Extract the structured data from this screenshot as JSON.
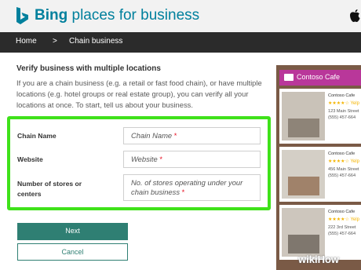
{
  "header": {
    "brand_bold": "Bing",
    "brand_rest": " places for business"
  },
  "breadcrumb": {
    "home": "Home",
    "separator": ">",
    "current": "Chain business"
  },
  "content": {
    "title": "Verify business with multiple locations",
    "description": "If you are a chain business (e.g. a retail or fast food chain), or have multiple locations (e.g. hotel groups or real estate group), you can verify all your locations at once. To start, tell us about your business."
  },
  "form": {
    "fields": [
      {
        "label": "Chain Name",
        "placeholder": "Chain Name",
        "required_mark": "*"
      },
      {
        "label": "Website",
        "placeholder": "Website",
        "required_mark": "*"
      },
      {
        "label": "Number of stores or centers",
        "placeholder": "No. of stores operating under your chain business",
        "required_mark": "*"
      }
    ],
    "highlight_color": "#3fe21a"
  },
  "buttons": {
    "next": "Next",
    "cancel": "Cancel"
  },
  "preview": {
    "title": "Contoso Cafe",
    "listings": [
      {
        "name": "Contoso Cafe",
        "stars": "★★★★☆ Yelp",
        "address": "123 Main Street",
        "phone": "(555) 457-664"
      },
      {
        "name": "Contoso Cafe",
        "stars": "★★★★☆ Yelp",
        "address": "456 Main Street",
        "phone": "(555) 457-664"
      },
      {
        "name": "Contoso Cafe",
        "stars": "★★★★☆ Yelp",
        "address": "222 3rd Street",
        "phone": "(555) 457-664"
      }
    ]
  },
  "watermark": "wikiHow",
  "colors": {
    "brand": "#00809d",
    "nav": "#2b2b2b",
    "button": "#2f7f73",
    "preview_accent": "#b9379a"
  },
  "icons": [
    "bing-logo-icon",
    "apple-icon",
    "cafe-icon"
  ]
}
